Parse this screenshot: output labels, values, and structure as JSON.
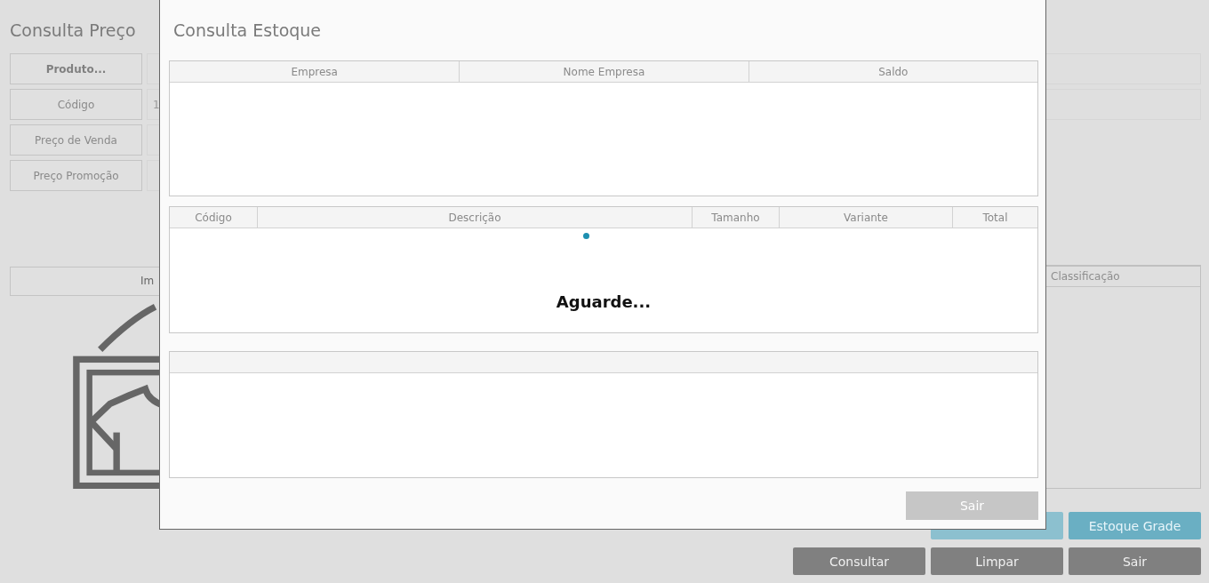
{
  "background_form": {
    "title": "Consulta Preço",
    "fields": [
      {
        "label": "Produto...",
        "kind": "button"
      },
      {
        "label": "Código",
        "kind": "label",
        "value": "1"
      },
      {
        "label": "Preço de Venda",
        "kind": "label"
      },
      {
        "label": "Preço Promoção",
        "kind": "label"
      }
    ],
    "image_button": "Im",
    "classification": {
      "header": "Classificação"
    },
    "action_rows": [
      [
        {
          "kind": "accent",
          "disabled": true
        },
        {
          "label": "Estoque Grade",
          "kind": "accent",
          "disabled": false
        }
      ],
      [
        {
          "label": "Consultar",
          "kind": "neutral",
          "disabled": false
        },
        {
          "label": "Limpar",
          "kind": "neutral",
          "disabled": false
        },
        {
          "label": "Sair",
          "kind": "neutral",
          "disabled": false
        }
      ]
    ]
  },
  "dialog": {
    "title": "Consulta Estoque",
    "company_table": {
      "columns": [
        "Empresa",
        "Nome Empresa",
        "Saldo"
      ]
    },
    "item_table": {
      "columns": [
        "Código",
        "Descrição",
        "Tamanho",
        "Variante",
        "Total"
      ],
      "loading": true,
      "loading_message": "Aguarde..."
    },
    "close_button": {
      "label": "Sair",
      "disabled": true
    }
  }
}
